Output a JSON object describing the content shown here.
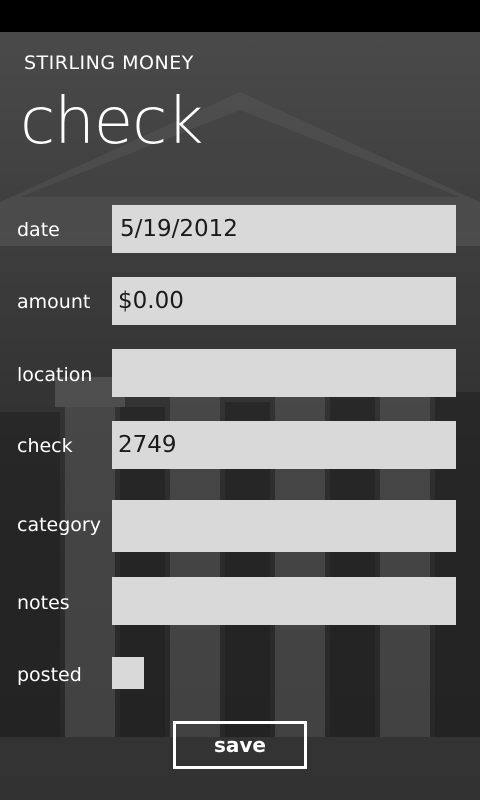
{
  "app_title": "STIRLING MONEY",
  "page_title": "check",
  "background_icon": "stock-exchange-building-photo",
  "colors": {
    "field_background": "#d9d9d9",
    "text": "#ffffff",
    "field_text": "#1a1a1a",
    "status_bar": "#000000"
  },
  "form": {
    "date": {
      "label": "date",
      "value": "5/19/2012"
    },
    "amount": {
      "label": "amount",
      "value": "$0.00"
    },
    "location": {
      "label": "location",
      "value": ""
    },
    "check": {
      "label": "check",
      "value": "2749"
    },
    "category": {
      "label": "category",
      "value": ""
    },
    "notes": {
      "label": "notes",
      "value": ""
    },
    "posted": {
      "label": "posted",
      "checked": false
    }
  },
  "actions": {
    "save_label": "save"
  }
}
